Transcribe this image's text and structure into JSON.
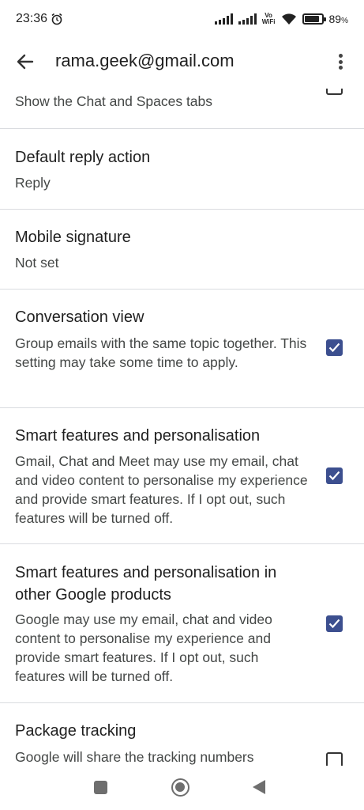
{
  "status_bar": {
    "time": "23:36",
    "vowifi_top": "Vo",
    "vowifi_bottom": "WiFi",
    "battery": "89",
    "battery_unit": "%"
  },
  "app_bar": {
    "title": "rama.geek@gmail.com"
  },
  "settings": {
    "chat_spaces": {
      "subtitle": "Show the Chat and Spaces tabs"
    },
    "default_reply": {
      "title": "Default reply action",
      "subtitle": "Reply"
    },
    "mobile_signature": {
      "title": "Mobile signature",
      "subtitle": "Not set"
    },
    "conversation_view": {
      "title": "Conversation view",
      "subtitle": "Group emails with the same topic together. This setting may take some time to apply.",
      "checked": true
    },
    "smart_features": {
      "title": "Smart features and personalisation",
      "subtitle": "Gmail, Chat and Meet may use my email, chat and video content to personalise my experience and provide smart features. If I opt out, such features will be turned off.",
      "checked": true
    },
    "smart_features_other": {
      "title": "Smart features and personalisation in other Google products",
      "subtitle": "Google may use my email, chat and video content to personalise my experience and provide smart features. If I opt out, such features will be turned off.",
      "checked": true
    },
    "package_tracking": {
      "title": "Package tracking",
      "subtitle": "Google will share the tracking numbers",
      "checked": false
    }
  },
  "colors": {
    "checkbox_checked": "#3c4f8f",
    "divider": "#dadce0",
    "text_primary": "#1f1f1f",
    "text_secondary": "#444746"
  }
}
